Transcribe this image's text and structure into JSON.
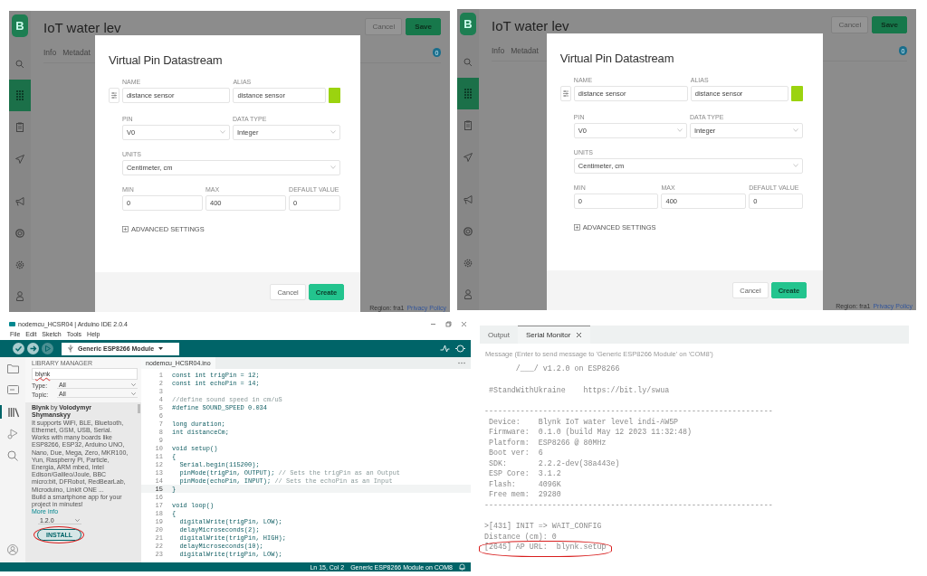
{
  "blynk_panels": [
    {
      "sidebar": {
        "top": [
          {
            "kind": "search",
            "selected": false
          },
          {
            "kind": "grid",
            "selected": true
          },
          {
            "kind": "clipboard",
            "selected": false
          },
          {
            "kind": "send",
            "selected": false
          }
        ],
        "bottom": [
          {
            "kind": "megaphone",
            "selected": false
          },
          {
            "kind": "lifebuoy",
            "selected": false
          },
          {
            "kind": "gear",
            "selected": false
          },
          {
            "kind": "person",
            "selected": false
          }
        ]
      },
      "logo": "B",
      "title": "IoT water lev",
      "tabs": [
        "Info",
        "Metadat"
      ],
      "header_buttons": [
        "Cancel",
        "Save"
      ],
      "badge": "0",
      "footer": "Region: fra1",
      "footer_link": "Privacy Policy",
      "modal": {
        "title": "Virtual Pin Datastream",
        "name": {
          "label": "NAME",
          "value": "distance sensor"
        },
        "alias": {
          "label": "ALIAS",
          "value": "distance sensor"
        },
        "color": "#9bd30f",
        "pin": {
          "label": "PIN",
          "value": "V0"
        },
        "data_type": {
          "label": "DATA TYPE",
          "value": "Integer"
        },
        "units": {
          "label": "UNITS",
          "value": "Centimeter, cm"
        },
        "min": {
          "label": "MIN",
          "value": "0"
        },
        "max": {
          "label": "MAX",
          "value": "400"
        },
        "default": {
          "label": "DEFAULT VALUE",
          "value": "0"
        },
        "advanced": "ADVANCED SETTINGS",
        "buttons": [
          "Cancel",
          "Create"
        ]
      }
    },
    {
      "sidebar": {
        "top": [
          {
            "kind": "search",
            "selected": false
          },
          {
            "kind": "grid",
            "selected": true
          },
          {
            "kind": "clipboard",
            "selected": false
          },
          {
            "kind": "send",
            "selected": false
          }
        ],
        "bottom": [
          {
            "kind": "megaphone",
            "selected": false
          },
          {
            "kind": "lifebuoy",
            "selected": false
          },
          {
            "kind": "gear",
            "selected": false
          },
          {
            "kind": "person",
            "selected": false
          }
        ]
      },
      "logo": "B",
      "title": "IoT water lev",
      "tabs": [
        "Info",
        "Metadat"
      ],
      "header_buttons": [
        "Cancel",
        "Save"
      ],
      "badge": "0",
      "footer": "Region: fra1",
      "footer_link": "Privacy Policy",
      "modal": {
        "title": "Virtual Pin Datastream",
        "name": {
          "label": "NAME",
          "value": "distance sensor"
        },
        "alias": {
          "label": "ALIAS",
          "value": "distance sensor"
        },
        "color": "#9bd30f",
        "pin": {
          "label": "PIN",
          "value": "V0"
        },
        "data_type": {
          "label": "DATA TYPE",
          "value": "Integer"
        },
        "units": {
          "label": "UNITS",
          "value": "Centimeter, cm"
        },
        "min": {
          "label": "MIN",
          "value": "0"
        },
        "max": {
          "label": "MAX",
          "value": "400"
        },
        "default": {
          "label": "DEFAULT VALUE",
          "value": "0"
        },
        "advanced": "ADVANCED SETTINGS",
        "buttons": [
          "Cancel",
          "Create"
        ]
      }
    }
  ],
  "arduino_ide": {
    "title": "nodemcu_HCSR04 | Arduino IDE 2.0.4",
    "menu": [
      "File",
      "Edit",
      "Sketch",
      "Tools",
      "Help"
    ],
    "board": "Generic ESP8266 Module",
    "activity_bar": [
      {
        "kind": "folder",
        "selected": false
      },
      {
        "kind": "boards",
        "selected": false
      },
      {
        "kind": "library",
        "selected": true
      },
      {
        "kind": "debug",
        "selected": false
      },
      {
        "kind": "search",
        "selected": false
      }
    ],
    "library_manager": {
      "title": "LIBRARY MANAGER",
      "search": "blynk",
      "filters": [
        {
          "label": "Type:",
          "value": "All"
        },
        {
          "label": "Topic:",
          "value": "All"
        }
      ],
      "library": {
        "heading": "**Blynk** by **Volodymyr Shymanskyy**",
        "description": "It supports WiFi, BLE, Bluetooth, Ethernet, GSM, USB, Serial. Works with many boards like ESP8266, ESP32, Arduino UNO, Nano, Due, Mega, Zero, MKR100, Yun, Raspberry Pi, Particle, Energia, ARM mbed, Intel Edison/Galileo/Joule, BBC micro:bit, DFRobot, RedBearLab, Microduino, LinkIt ONE ...",
        "tagline": "Build a smartphone app for your project in minutes!",
        "link": "More info",
        "version": "1.2.0",
        "install": {
          "label": "INSTALL",
          "circled": true
        }
      }
    },
    "editor": {
      "tab": "nodemcu_HCSR04.ino",
      "lines": [
        {
          "number": "1",
          "code": "const int trigPin = 12;",
          "current": false
        },
        {
          "number": "2",
          "code": "const int echoPin = 14;",
          "current": false
        },
        {
          "number": "3",
          "current": false
        },
        {
          "number": "4",
          "comment": "//define sound speed in cm/uS",
          "current": false
        },
        {
          "number": "5",
          "code": "#define SOUND_SPEED 0.034",
          "current": false
        },
        {
          "number": "6",
          "current": false
        },
        {
          "number": "7",
          "code": "long duration;",
          "current": false
        },
        {
          "number": "8",
          "code": "int distanceCm;",
          "current": false
        },
        {
          "number": "9",
          "current": false
        },
        {
          "number": "10",
          "code": "void setup()",
          "current": false
        },
        {
          "number": "11",
          "code": "{",
          "current": false
        },
        {
          "number": "12",
          "code": "  Serial.begin(115200);",
          "current": false
        },
        {
          "number": "13",
          "code": "  pinMode(trigPin, OUTPUT);",
          "comment": " // Sets the trigPin as an Output",
          "current": false
        },
        {
          "number": "14",
          "code": "  pinMode(echoPin, INPUT);",
          "comment": " // Sets the echoPin as an Input",
          "current": false
        },
        {
          "number": "15",
          "code": "}",
          "current": true
        },
        {
          "number": "16",
          "current": false
        },
        {
          "number": "17",
          "code": "void loop()",
          "current": false
        },
        {
          "number": "18",
          "code": "{",
          "current": false
        },
        {
          "number": "19",
          "code": "  digitalWrite(trigPin, LOW);",
          "current": false
        },
        {
          "number": "20",
          "code": "  delayMicroseconds(2);",
          "current": false
        },
        {
          "number": "21",
          "code": "  digitalWrite(trigPin, HIGH);",
          "current": false
        },
        {
          "number": "22",
          "code": "  delayMicroseconds(10);",
          "current": false
        },
        {
          "number": "23",
          "code": "  digitalWrite(trigPin, LOW);",
          "current": false
        }
      ]
    },
    "status": "Ln 15, Col 2",
    "status_board": "Generic ESP8266 Module on COM8"
  },
  "serial_monitor": {
    "tabs": [
      {
        "label": "Output",
        "selected": false,
        "closable": false
      },
      {
        "label": "Serial Monitor",
        "selected": true,
        "closable": true
      }
    ],
    "message_placeholder": "Message (Enter to send message to 'Generic ESP8266 Module' on 'COM8')",
    "blocks": [
      [
        {
          "text": "       /___/ v1.2.0 on ESP8266",
          "circled": false
        }
      ],
      [
        {
          "text": " #StandWithUkraine    https://bit.ly/swua",
          "circled": false
        }
      ],
      [
        {
          "text": "----------------------------------------------------------------",
          "circled": false
        },
        {
          "text": " Device:    Blynk IoT water level indi-AW5P",
          "circled": false
        },
        {
          "text": " Firmware:  0.1.0 (build May 12 2023 11:32:48)",
          "circled": false
        },
        {
          "text": " Platform:  ESP8266 @ 80MHz",
          "circled": false
        },
        {
          "text": " Boot ver:  6",
          "circled": false
        },
        {
          "text": " SDK:       2.2.2-dev(38a443e)",
          "circled": false
        },
        {
          "text": " ESP Core:  3.1.2",
          "circled": false
        },
        {
          "text": " Flash:     4096K",
          "circled": false
        },
        {
          "text": " Free mem:  29280",
          "circled": false
        },
        {
          "text": "----------------------------------------------------------------",
          "circled": false
        }
      ],
      [
        {
          "text": ">[431] INIT => WAIT_CONFIG",
          "circled": false
        },
        {
          "text": "Distance (cm): 0",
          "circled": false
        },
        {
          "text": "[2645] AP URL:  blynk.setup",
          "circled": true
        }
      ]
    ]
  }
}
